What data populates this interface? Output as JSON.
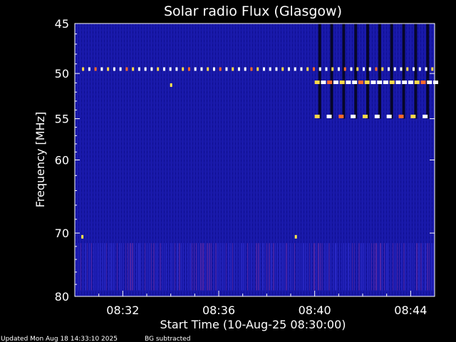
{
  "chart_data": {
    "type": "heatmap",
    "title": "Solar radio Flux (Glasgow)",
    "xlabel": "Start Time (10-Aug-25 08:30:00)",
    "ylabel": "Frequency [MHz]",
    "x_range_minutes": [
      0,
      15
    ],
    "x_ticks": [
      {
        "minute": 2,
        "label": "08:32"
      },
      {
        "minute": 6,
        "label": "08:36"
      },
      {
        "minute": 10,
        "label": "08:40"
      },
      {
        "minute": 14,
        "label": "08:44"
      }
    ],
    "y_range_mhz": [
      45,
      80
    ],
    "y_scale": "log",
    "y_ticks": [
      {
        "value": 45,
        "label": "45"
      },
      {
        "value": 50,
        "label": "50"
      },
      {
        "value": 55,
        "label": "55"
      },
      {
        "value": 60,
        "label": "60"
      },
      {
        "value": 70,
        "label": "70"
      },
      {
        "value": 80,
        "label": "80"
      }
    ],
    "background_color": "#1414a0",
    "features": [
      {
        "kind": "narrowband-line",
        "freq_mhz": 49.5,
        "minute_start": 0.3,
        "minute_end": 15
      },
      {
        "kind": "narrowband-line",
        "freq_mhz": 50.9,
        "minute_start": 10.0,
        "minute_end": 15
      },
      {
        "kind": "narrowband-line",
        "freq_mhz": 54.7,
        "minute_start": 10.0,
        "minute_end": 15
      },
      {
        "kind": "burst",
        "freq_mhz": 51.2,
        "minute": 4.0
      },
      {
        "kind": "burst",
        "freq_mhz": 70.5,
        "minute": 0.3
      },
      {
        "kind": "burst",
        "freq_mhz": 70.5,
        "minute": 9.2
      },
      {
        "kind": "broadband-stripes",
        "freq_mhz_start": 45,
        "freq_mhz_end": 55,
        "minute_start": 10.0,
        "minute_end": 15
      }
    ]
  },
  "footer": {
    "updated": "Updated Mon Aug 18 14:33:10 2025",
    "note": "BG subtracted"
  }
}
